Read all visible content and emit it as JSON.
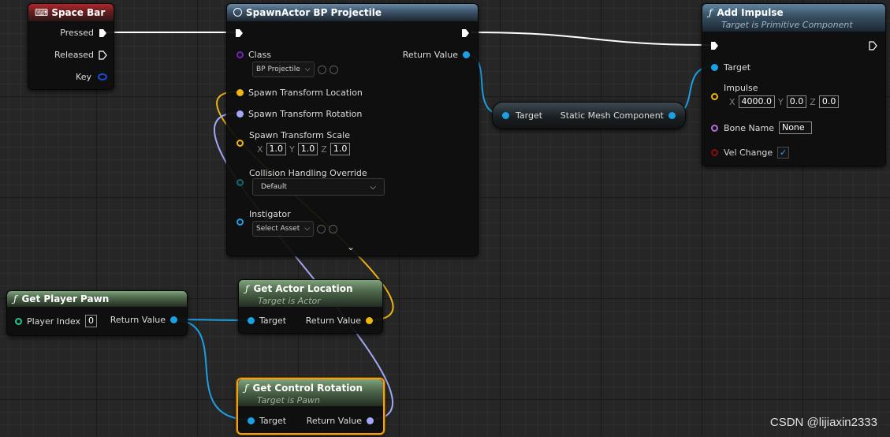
{
  "nodes": {
    "space_bar": {
      "title": "Space Bar",
      "pins": {
        "pressed": "Pressed",
        "released": "Released",
        "key": "Key"
      }
    },
    "spawn_actor": {
      "title": "SpawnActor BP Projectile",
      "class_label": "Class",
      "class_value": "BP Projectile",
      "return_value": "Return Value",
      "spawn_location": "Spawn Transform Location",
      "spawn_rotation": "Spawn Transform Rotation",
      "spawn_scale": "Spawn Transform Scale",
      "scale": {
        "x_label": "X",
        "x": "1.0",
        "y_label": "Y",
        "y": "1.0",
        "z_label": "Z",
        "z": "1.0"
      },
      "collision_label": "Collision Handling Override",
      "collision_value": "Default",
      "instigator_label": "Instigator",
      "instigator_value": "Select Asset"
    },
    "static_mesh": {
      "target": "Target",
      "output": "Static Mesh Component"
    },
    "add_impulse": {
      "title": "Add Impulse",
      "subtitle": "Target is Primitive Component",
      "target": "Target",
      "impulse_label": "Impulse",
      "impulse": {
        "x_label": "X",
        "x": "4000.0",
        "y_label": "Y",
        "y": "0.0",
        "z_label": "Z",
        "z": "0.0"
      },
      "bone_name_label": "Bone Name",
      "bone_name_value": "None",
      "vel_change_label": "Vel Change",
      "vel_change_checked": true
    },
    "get_player_pawn": {
      "title": "Get Player Pawn",
      "player_index_label": "Player Index",
      "player_index_value": "0",
      "return_value": "Return Value"
    },
    "get_actor_location": {
      "title": "Get Actor Location",
      "subtitle": "Target is Actor",
      "target": "Target",
      "return_value": "Return Value"
    },
    "get_control_rotation": {
      "title": "Get Control Rotation",
      "subtitle": "Target is Pawn",
      "target": "Target",
      "return_value": "Return Value"
    }
  },
  "glyphs": {
    "function": "ƒ",
    "keyboard": "⌨",
    "check": "✓",
    "chevron": "⌄"
  },
  "colors": {
    "exec": "#ffffff",
    "object": "#19a0e5",
    "vector": "#f0b60f",
    "rotator": "#a3a7f5",
    "class": "#7622b5",
    "selected_outline": "#f3a012"
  },
  "watermark": "CSDN @lijiaxin2333"
}
